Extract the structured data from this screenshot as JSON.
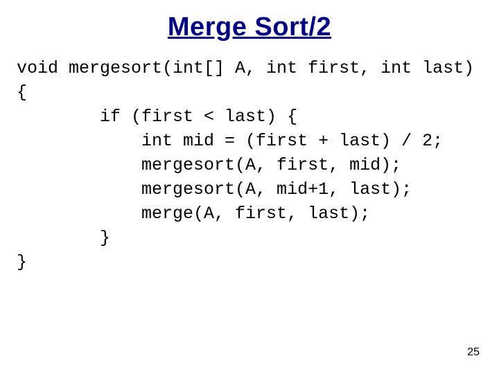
{
  "title": "Merge Sort/2",
  "code": {
    "l0": "void mergesort(int[] A, int first, int last)",
    "l1": "{",
    "l2": "        if (first < last) {",
    "l3": "            int mid = (first + last) / 2;",
    "l4": "            mergesort(A, first, mid);",
    "l5": "            mergesort(A, mid+1, last);",
    "l6": "            merge(A, first, last);",
    "l7": "        }",
    "l8": "}"
  },
  "page_number": "25"
}
